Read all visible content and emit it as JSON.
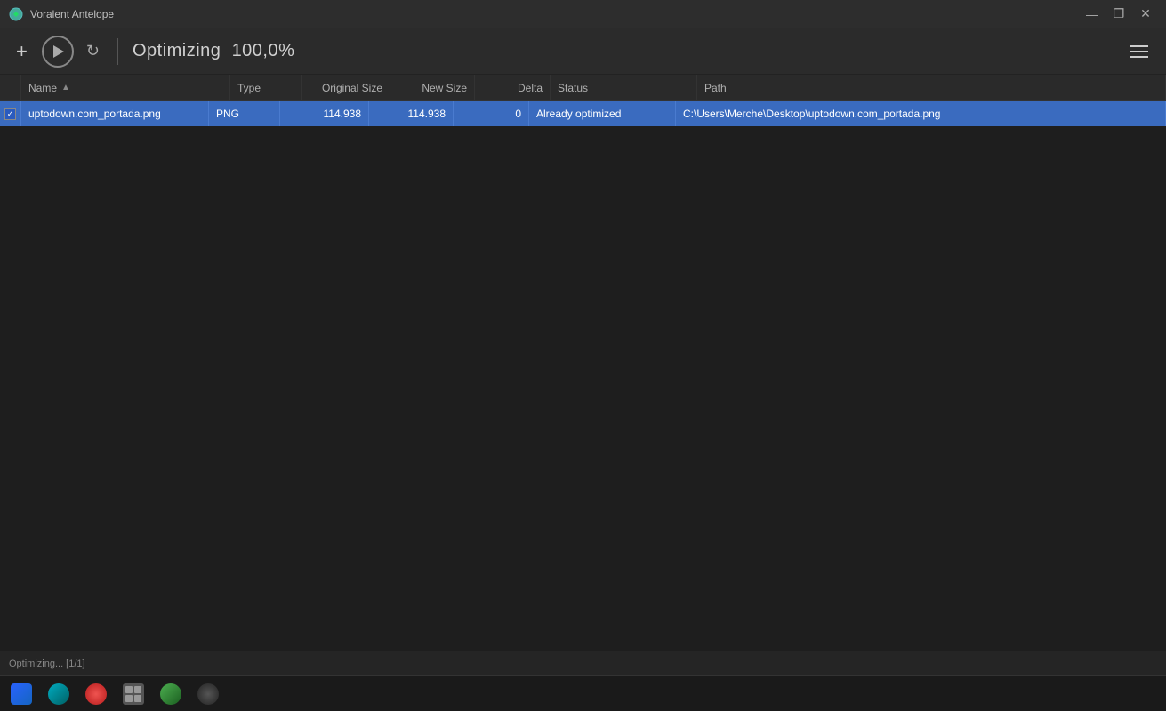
{
  "window": {
    "title": "Voralent Antelope",
    "controls": {
      "minimize": "—",
      "restore": "❐",
      "close": "✕"
    }
  },
  "toolbar": {
    "add_label": "+",
    "play_tooltip": "Optimize",
    "refresh_tooltip": "Refresh",
    "title": "Optimizing",
    "progress": "100,0%",
    "menu_tooltip": "Menu"
  },
  "table": {
    "columns": [
      {
        "id": "name",
        "label": "Name",
        "sort": "asc"
      },
      {
        "id": "type",
        "label": "Type"
      },
      {
        "id": "original_size",
        "label": "Original Size"
      },
      {
        "id": "new_size",
        "label": "New Size"
      },
      {
        "id": "delta",
        "label": "Delta"
      },
      {
        "id": "status",
        "label": "Status"
      },
      {
        "id": "path",
        "label": "Path"
      }
    ],
    "rows": [
      {
        "checked": true,
        "name": "uptodown.com_portada.png",
        "type": "PNG",
        "original_size": "114.938",
        "new_size": "114.938",
        "delta": "0",
        "status": "Already optimized",
        "path": "C:\\Users\\Merche\\Desktop\\uptodown.com_portada.png",
        "selected": true
      }
    ]
  },
  "statusbar": {
    "text": "Optimizing... [1/1]"
  },
  "taskbar": {
    "items": [
      {
        "name": "blue-app",
        "type": "blue-square"
      },
      {
        "name": "teal-app",
        "type": "teal-circle"
      },
      {
        "name": "red-app",
        "type": "red-circle"
      },
      {
        "name": "grid-app",
        "type": "grid"
      },
      {
        "name": "green-app",
        "type": "green-circle"
      },
      {
        "name": "dark-app",
        "type": "dark-circle"
      }
    ]
  }
}
